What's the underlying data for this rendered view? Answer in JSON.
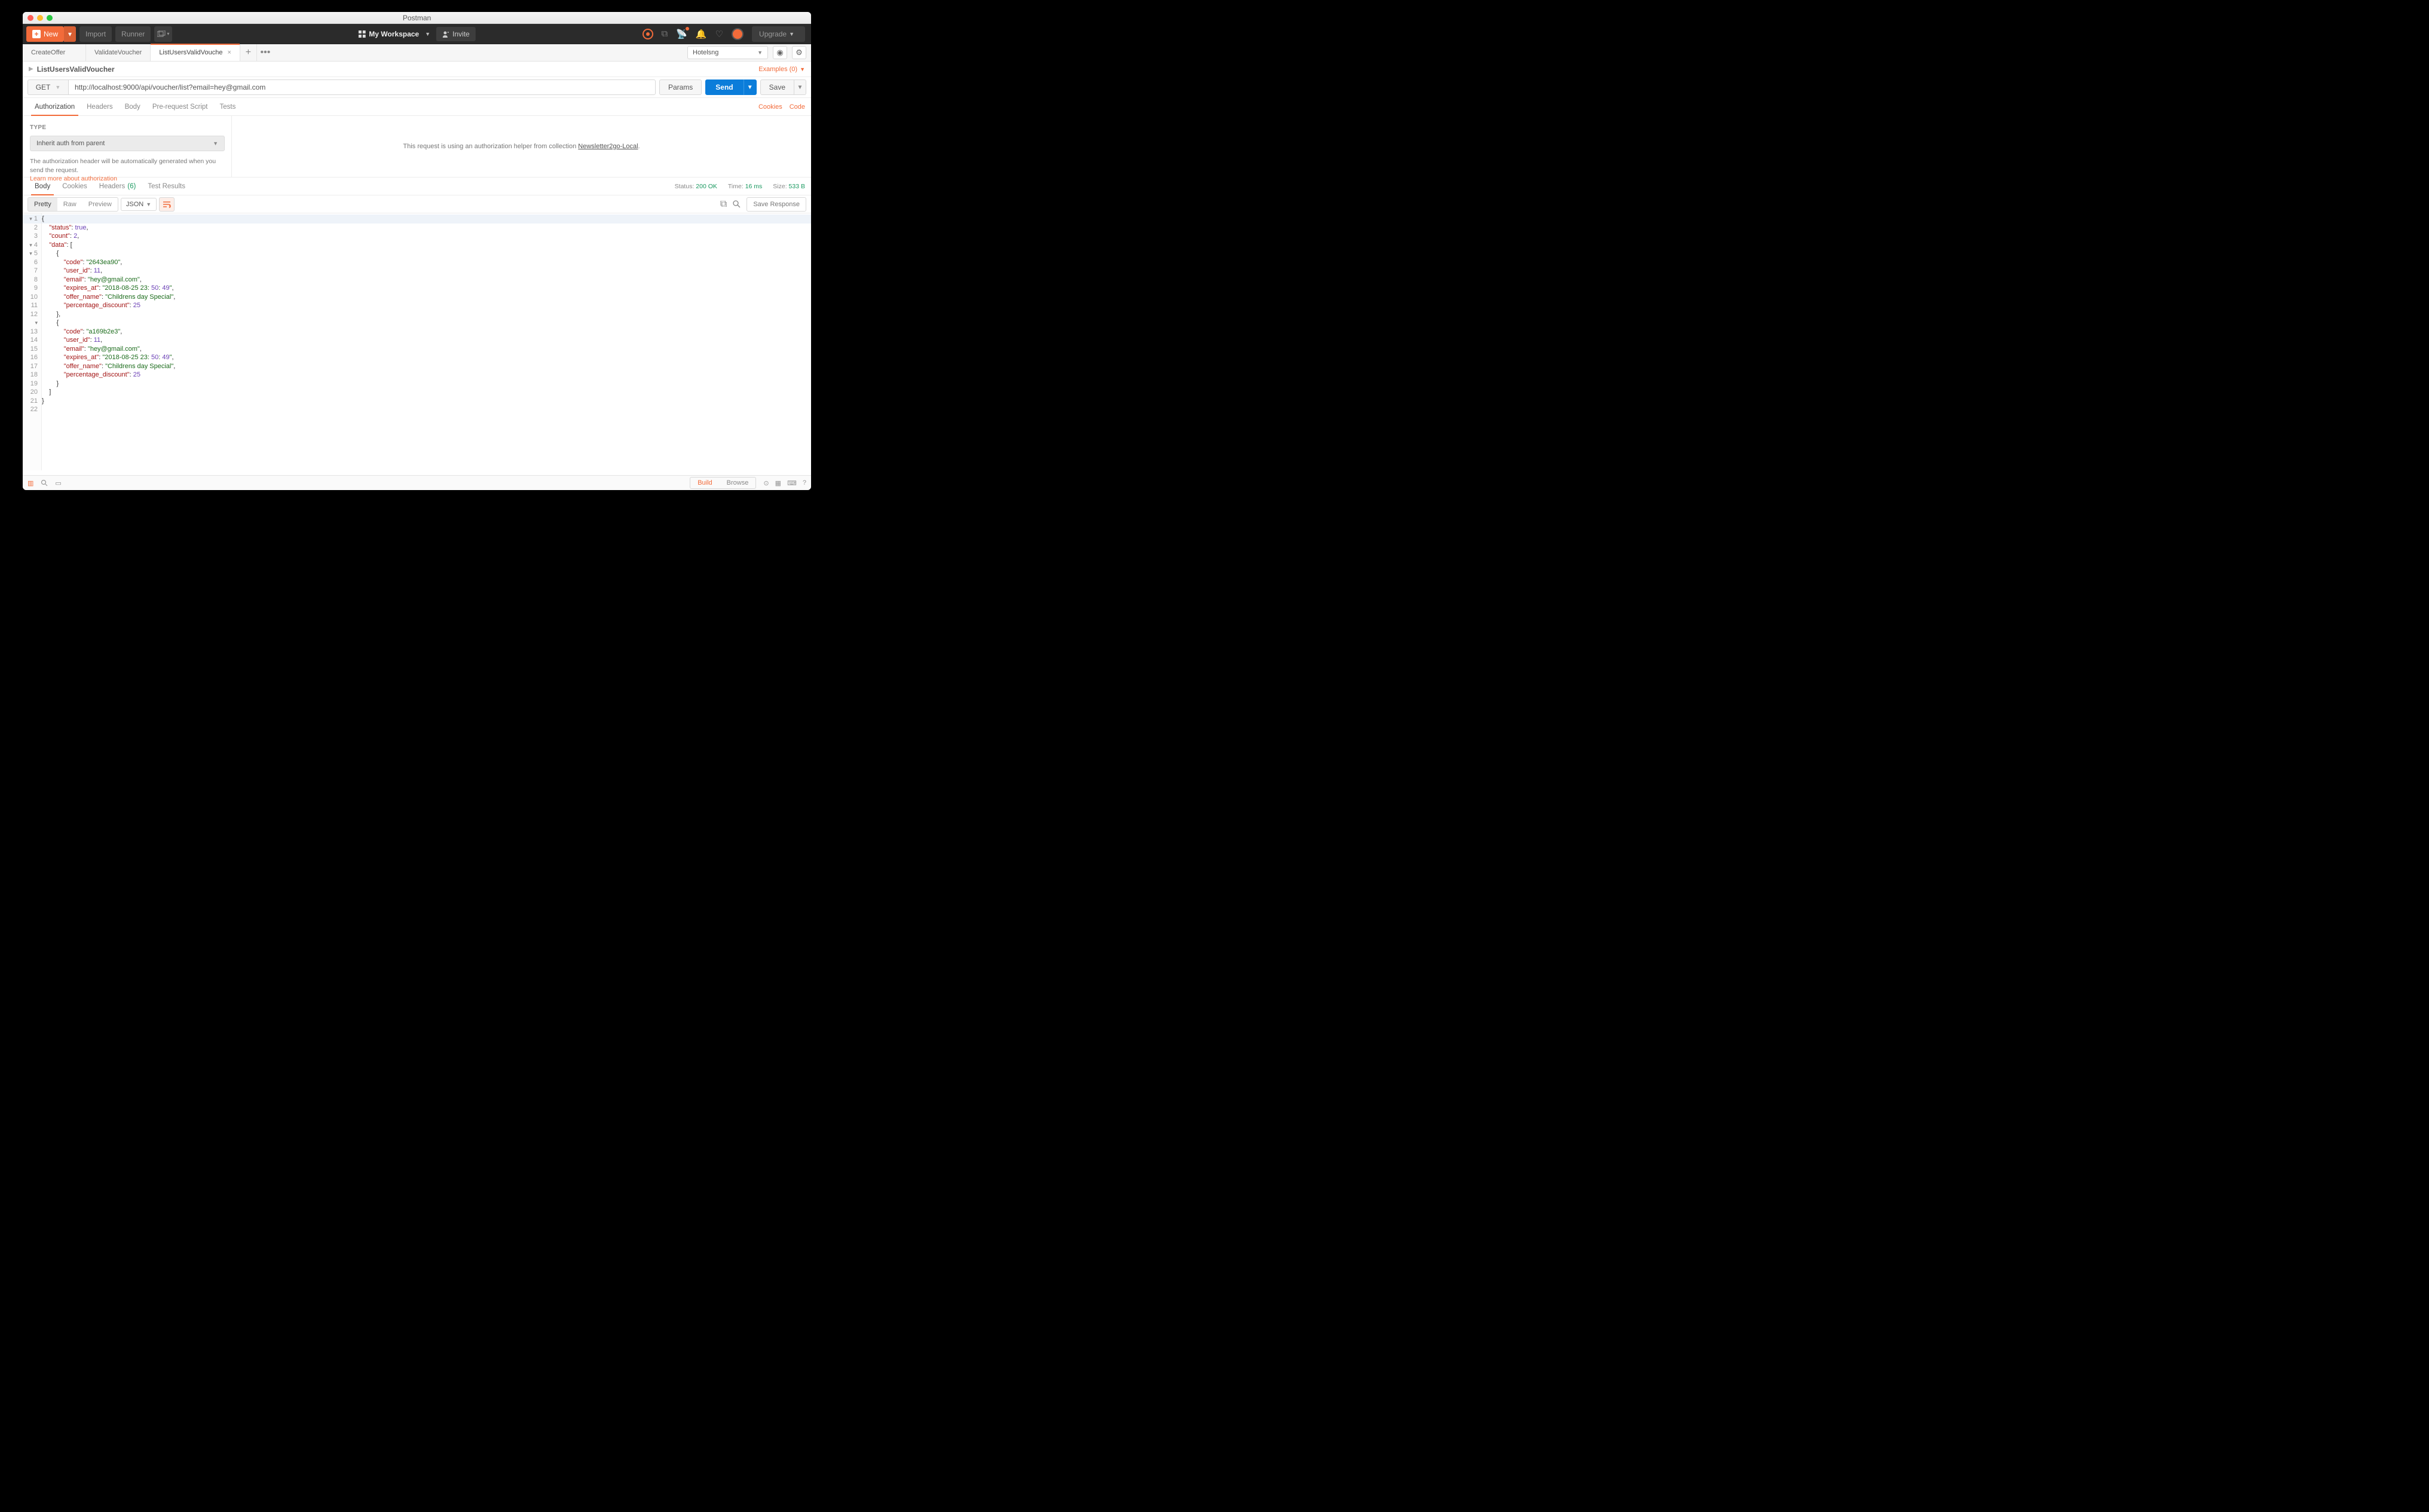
{
  "app_title": "Postman",
  "header": {
    "new": "New",
    "import": "Import",
    "runner": "Runner",
    "workspace": "My Workspace",
    "invite": "Invite",
    "upgrade": "Upgrade"
  },
  "tabs": {
    "items": [
      {
        "label": "CreateOffer"
      },
      {
        "label": "ValidateVoucher"
      },
      {
        "label": "ListUsersValidVouche"
      }
    ],
    "env": "Hotelsng"
  },
  "breadcrumb": {
    "name": "ListUsersValidVoucher",
    "examples": "Examples (0)"
  },
  "request": {
    "method": "GET",
    "url": "http://localhost:9000/api/voucher/list?email=hey@gmail.com",
    "params": "Params",
    "send": "Send",
    "save": "Save"
  },
  "reqtabs": {
    "authorization": "Authorization",
    "headers": "Headers",
    "body": "Body",
    "prerequest": "Pre-request Script",
    "tests": "Tests",
    "cookies": "Cookies",
    "code": "Code"
  },
  "auth": {
    "type_label": "TYPE",
    "type_value": "Inherit auth from parent",
    "desc1": "The authorization header will be automatically generated when you send the request.",
    "learn": "Learn more about authorization",
    "helper": "This request is using an authorization helper from collection ",
    "collection": "Newsletter2go-Local"
  },
  "resptabs": {
    "body": "Body",
    "cookies": "Cookies",
    "headers": "Headers",
    "headers_count": "(6)",
    "tests": "Test Results",
    "status_label": "Status:",
    "status_value": "200 OK",
    "time_label": "Time:",
    "time_value": "16 ms",
    "size_label": "Size:",
    "size_value": "533 B"
  },
  "viewopts": {
    "pretty": "Pretty",
    "raw": "Raw",
    "preview": "Preview",
    "format": "JSON",
    "save_response": "Save Response"
  },
  "response_lines": [
    "{",
    "    \"status\": true,",
    "    \"count\": 2,",
    "    \"data\": [",
    "        {",
    "            \"code\": \"2643ea90\",",
    "            \"user_id\": 11,",
    "            \"email\": \"hey@gmail.com\",",
    "            \"expires_at\": \"2018-08-25 23:50:49\",",
    "            \"offer_name\": \"Childrens day Special\",",
    "            \"percentage_discount\": 25",
    "        },",
    "        {",
    "            \"code\": \"a169b2e3\",",
    "            \"user_id\": 11,",
    "            \"email\": \"hey@gmail.com\",",
    "            \"expires_at\": \"2018-08-25 23:50:49\",",
    "            \"offer_name\": \"Childrens day Special\",",
    "            \"percentage_discount\": 25",
    "        }",
    "    ]",
    "}"
  ],
  "statusbar": {
    "build": "Build",
    "browse": "Browse"
  }
}
